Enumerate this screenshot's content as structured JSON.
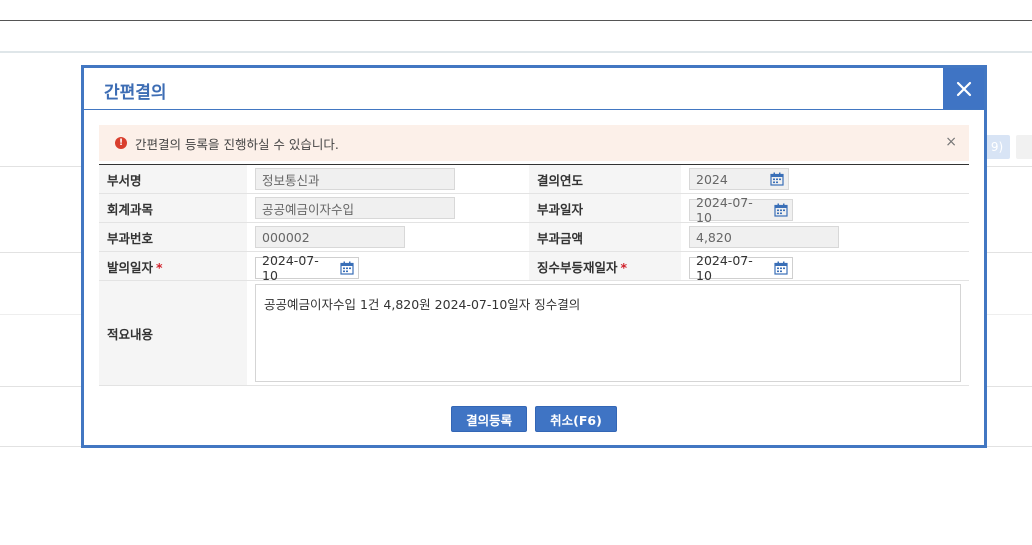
{
  "background": {
    "button_label": "9)"
  },
  "modal": {
    "title": "간편결의",
    "close_icon": "close-icon",
    "alert": {
      "icon": "alert-circle-icon",
      "icon_glyph": "!",
      "message": "간편결의 등록을 진행하실 수 있습니다.",
      "close_glyph": "×"
    },
    "form": {
      "dept_label": "부서명",
      "dept_value": "정보통신과",
      "year_label": "결의연도",
      "year_value": "2024",
      "account_label": "회계과목",
      "account_value": "공공예금이자수입",
      "levy_date_label": "부과일자",
      "levy_date_value": "2024-07-10",
      "levy_no_label": "부과번호",
      "levy_no_value": "000002",
      "levy_amount_label": "부과금액",
      "levy_amount_value": "4,820",
      "proposal_date_label": "발의일자",
      "proposal_date_value": "2024-07-10",
      "ledger_date_label": "징수부등재일자",
      "ledger_date_value": "2024-07-10",
      "summary_label": "적요내용",
      "summary_value": "공공예금이자수입 1건 4,820원 2024-07-10일자 징수결의",
      "required_mark": "*"
    },
    "buttons": {
      "register": "결의등록",
      "cancel": "취소(F6)"
    }
  },
  "colors": {
    "accent": "#3f74c4",
    "alert_bg": "#fcf0e9",
    "alert_icon": "#d93f2e",
    "required": "#d0202a"
  }
}
